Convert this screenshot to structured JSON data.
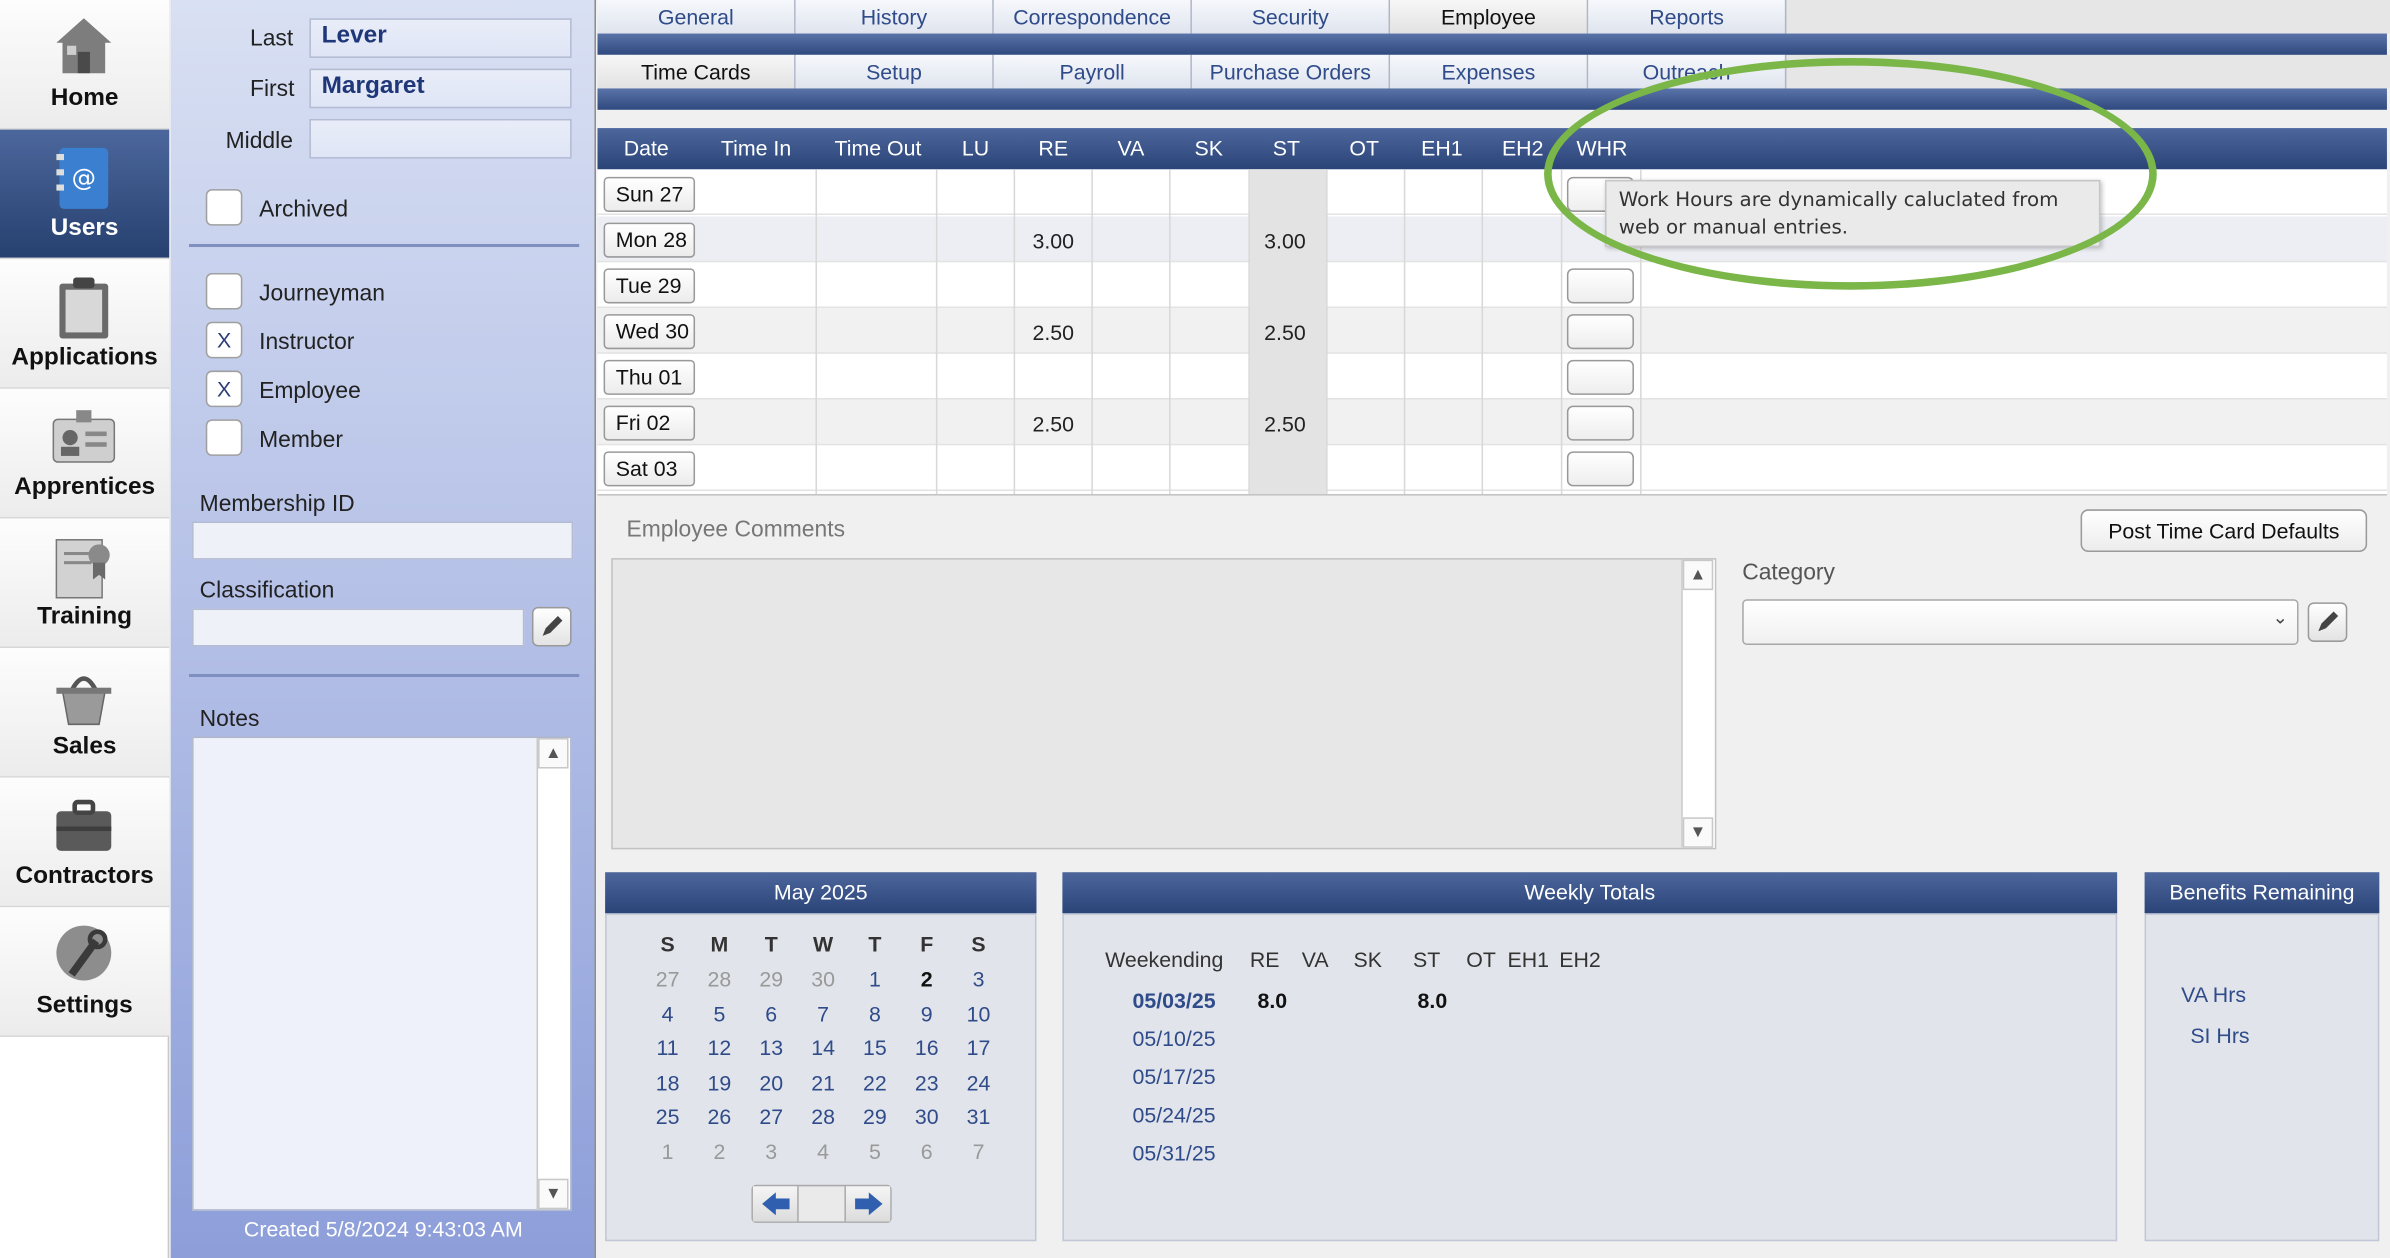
{
  "nav": {
    "items": [
      {
        "label": "Home",
        "icon": "house-icon"
      },
      {
        "label": "Users",
        "icon": "address-book-icon"
      },
      {
        "label": "Applications",
        "icon": "clipboard-icon"
      },
      {
        "label": "Apprentices",
        "icon": "id-badge-icon"
      },
      {
        "label": "Training",
        "icon": "certificate-icon"
      },
      {
        "label": "Sales",
        "icon": "basket-icon"
      },
      {
        "label": "Contractors",
        "icon": "briefcase-icon"
      },
      {
        "label": "Settings",
        "icon": "wrench-icon"
      }
    ],
    "active": "Users"
  },
  "user": {
    "last_label": "Last",
    "last": "Lever",
    "first_label": "First",
    "first": "Margaret",
    "middle_label": "Middle",
    "middle": "",
    "archived_label": "Archived",
    "archived": "",
    "roles": [
      {
        "label": "Journeyman",
        "checked": ""
      },
      {
        "label": "Instructor",
        "checked": "X"
      },
      {
        "label": "Employee",
        "checked": "X"
      },
      {
        "label": "Member",
        "checked": ""
      }
    ],
    "membership_label": "Membership ID",
    "membership": "",
    "classification_label": "Classification",
    "classification": "",
    "notes_label": "Notes",
    "notes": "",
    "created": "Created 5/8/2024 9:43:03 AM"
  },
  "tabs": {
    "main": [
      "General",
      "History",
      "Correspondence",
      "Security",
      "Employee",
      "Reports"
    ],
    "main_selected": "Employee",
    "sub": [
      "Time Cards",
      "Setup",
      "Payroll",
      "Purchase Orders",
      "Expenses",
      "Outreach"
    ],
    "sub_selected": "Time Cards"
  },
  "timecard": {
    "columns": [
      "Date",
      "Time In",
      "Time Out",
      "LU",
      "RE",
      "VA",
      "SK",
      "ST",
      "OT",
      "EH1",
      "EH2",
      "WHR"
    ],
    "rows": [
      {
        "date": "Sun 27",
        "re": "",
        "st": ""
      },
      {
        "date": "Mon 28",
        "re": "3.00",
        "st": "3.00"
      },
      {
        "date": "Tue 29",
        "re": "",
        "st": ""
      },
      {
        "date": "Wed 30",
        "re": "2.50",
        "st": "2.50"
      },
      {
        "date": "Thu 01",
        "re": "",
        "st": ""
      },
      {
        "date": "Fri 02",
        "re": "2.50",
        "st": "2.50"
      },
      {
        "date": "Sat 03",
        "re": "",
        "st": ""
      }
    ]
  },
  "tooltip": {
    "text": "Work Hours are dynamically caluclated from web or manual entries."
  },
  "annotation": {
    "color": "#7ab648"
  },
  "comments": {
    "label": "Employee Comments",
    "value": ""
  },
  "post_defaults_label": "Post Time Card Defaults",
  "category": {
    "label": "Category",
    "value": ""
  },
  "calendar": {
    "title": "May 2025",
    "weekdays": [
      "S",
      "M",
      "T",
      "W",
      "T",
      "F",
      "S"
    ],
    "weeks": [
      [
        "27",
        "28",
        "29",
        "30",
        "1",
        "2",
        "3"
      ],
      [
        "4",
        "5",
        "6",
        "7",
        "8",
        "9",
        "10"
      ],
      [
        "11",
        "12",
        "13",
        "14",
        "15",
        "16",
        "17"
      ],
      [
        "18",
        "19",
        "20",
        "21",
        "22",
        "23",
        "24"
      ],
      [
        "25",
        "26",
        "27",
        "28",
        "29",
        "30",
        "31"
      ],
      [
        "1",
        "2",
        "3",
        "4",
        "5",
        "6",
        "7"
      ]
    ],
    "selected": "2"
  },
  "weekly_totals": {
    "title": "Weekly Totals",
    "headers": [
      "Weekending",
      "RE",
      "VA",
      "SK",
      "ST",
      "OT",
      "EH1",
      "EH2"
    ],
    "rows": [
      {
        "date": "05/03/25",
        "re": "8.0",
        "st": "8.0"
      },
      {
        "date": "05/10/25",
        "re": "",
        "st": ""
      },
      {
        "date": "05/17/25",
        "re": "",
        "st": ""
      },
      {
        "date": "05/24/25",
        "re": "",
        "st": ""
      },
      {
        "date": "05/31/25",
        "re": "",
        "st": ""
      }
    ]
  },
  "benefits": {
    "title": "Benefits Remaining",
    "items": [
      "VA Hrs",
      "SI Hrs"
    ]
  },
  "colors": {
    "nav_active": "#26406f",
    "header_blue": "#2a4478",
    "link": "#2f4b8a"
  }
}
